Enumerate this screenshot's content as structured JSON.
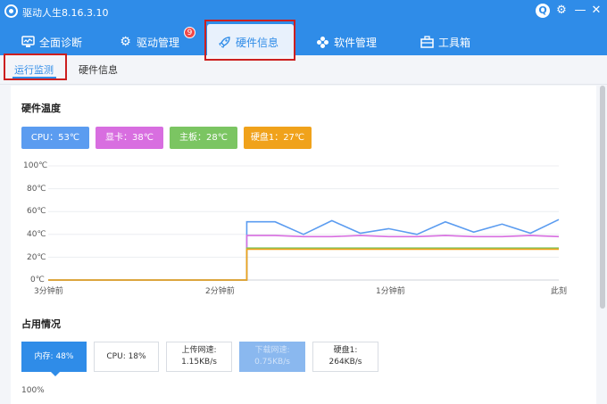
{
  "window": {
    "title": "驱动人生8.16.3.10"
  },
  "nav": {
    "items": [
      {
        "label": "全面诊断",
        "icon": "monitor-icon"
      },
      {
        "label": "驱动管理",
        "icon": "gear-icon",
        "badge": "9"
      },
      {
        "label": "硬件信息",
        "icon": "rocket-icon",
        "active": true
      },
      {
        "label": "软件管理",
        "icon": "apps-icon"
      },
      {
        "label": "工具箱",
        "icon": "toolbox-icon"
      }
    ]
  },
  "subtabs": [
    {
      "label": "运行监测",
      "active": true
    },
    {
      "label": "硬件信息"
    }
  ],
  "temperature": {
    "title": "硬件温度",
    "badges": [
      {
        "label": "CPU：53℃",
        "color": "#5b9cf0"
      },
      {
        "label": "显卡：38℃",
        "color": "#d86ee0"
      },
      {
        "label": "主板：28℃",
        "color": "#7bc562"
      },
      {
        "label": "硬盘1：27℃",
        "color": "#f0a21b"
      }
    ]
  },
  "chart_data": {
    "type": "line",
    "title": "",
    "xlabel": "",
    "ylabel": "",
    "ylim": [
      0,
      100
    ],
    "yticks": [
      "100℃",
      "80℃",
      "60℃",
      "40℃",
      "20℃",
      "0℃"
    ],
    "xticks": [
      "3分钟前",
      "2分钟前",
      "1分钟前",
      "此刻"
    ],
    "x": [
      0,
      10,
      20,
      30,
      40,
      50,
      60,
      70,
      80,
      90,
      100,
      110,
      120,
      130,
      140,
      150,
      160,
      170,
      180
    ],
    "series": [
      {
        "name": "CPU",
        "color": "#5b9cf0",
        "values": [
          0,
          0,
          0,
          0,
          0,
          0,
          0,
          0,
          51,
          40,
          52,
          41,
          45,
          40,
          51,
          42,
          49,
          41,
          53
        ]
      },
      {
        "name": "显卡",
        "color": "#d86ee0",
        "values": [
          0,
          0,
          0,
          0,
          0,
          0,
          0,
          0,
          39,
          38,
          38,
          39,
          38,
          38,
          39,
          38,
          38,
          39,
          38
        ]
      },
      {
        "name": "主板",
        "color": "#7bc562",
        "values": [
          0,
          0,
          0,
          0,
          0,
          0,
          0,
          0,
          28,
          28,
          28,
          28,
          28,
          28,
          28,
          28,
          28,
          28,
          28
        ]
      },
      {
        "name": "硬盘1",
        "color": "#f0a21b",
        "values": [
          0,
          0,
          0,
          0,
          0,
          0,
          0,
          0,
          27,
          27,
          27,
          27,
          27,
          27,
          27,
          27,
          27,
          27,
          27
        ]
      }
    ],
    "grid": true,
    "legend": "none"
  },
  "usage": {
    "title": "占用情况",
    "boxes": [
      {
        "label": "内存: 48%",
        "state": "active"
      },
      {
        "label": "CPU: 18%",
        "state": "normal"
      },
      {
        "label": "上传网速:",
        "value": "1.15KB/s",
        "state": "normal"
      },
      {
        "label": "下载网速:",
        "value": "0.75KB/s",
        "state": "dim"
      },
      {
        "label": "硬盘1:",
        "value": "264KB/s",
        "state": "normal"
      }
    ],
    "next_axis_top": "100%"
  }
}
